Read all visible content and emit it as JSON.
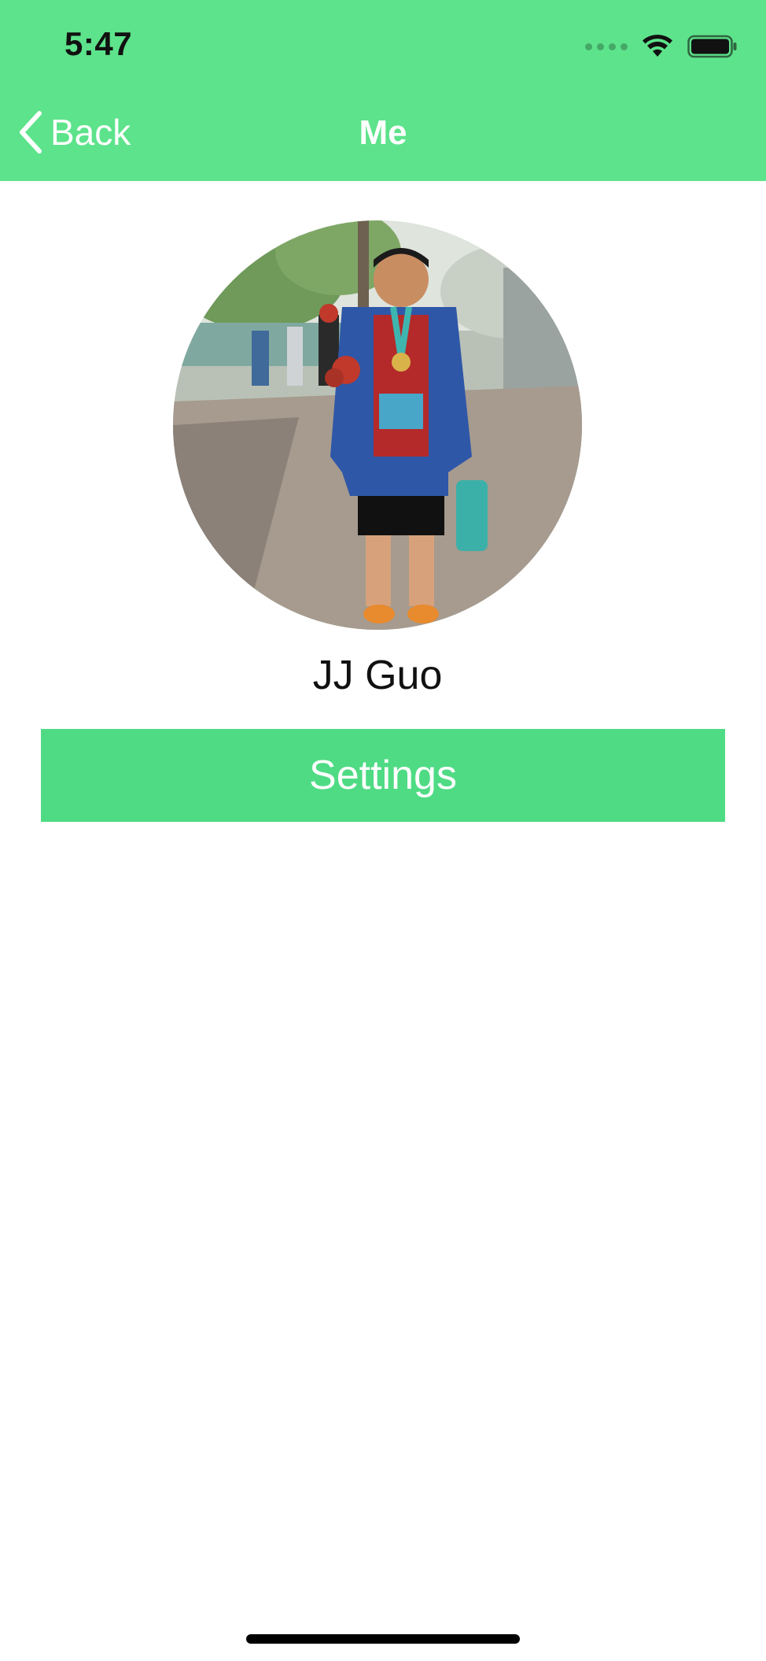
{
  "status_bar": {
    "time": "5:47",
    "icons": [
      "cellular-signal-icon",
      "wifi-icon",
      "battery-icon"
    ]
  },
  "nav": {
    "back_label": "Back",
    "title": "Me"
  },
  "profile": {
    "avatar": "profile-photo",
    "name": "JJ Guo"
  },
  "actions": {
    "settings_label": "Settings"
  },
  "colors": {
    "header_bg": "#5de38b",
    "button_bg": "#4fdb84",
    "text_white": "#ffffff",
    "text_dark": "#111111"
  }
}
